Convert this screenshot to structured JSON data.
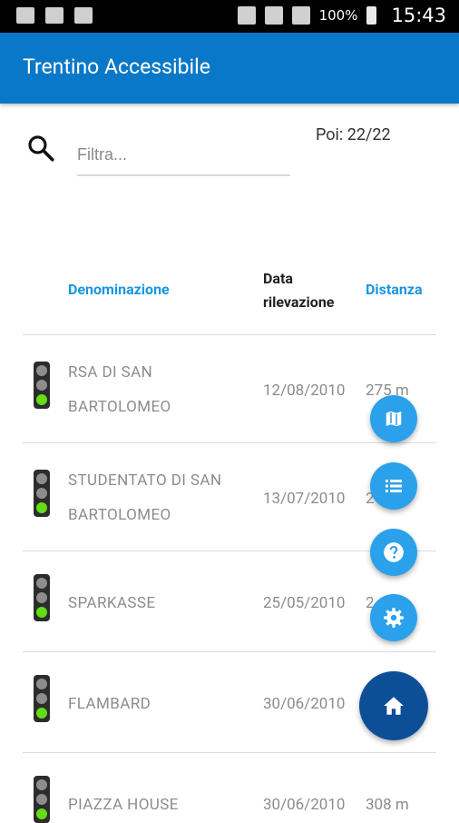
{
  "status_bar": {
    "battery": "100%",
    "time": "15:43"
  },
  "app_bar": {
    "title": "Trentino Accessibile"
  },
  "search": {
    "placeholder": "Filtra...",
    "value": ""
  },
  "poi_count": "Poi: 22/22",
  "columns": {
    "name": "Denominazione",
    "date": "Data rilevazione",
    "distance": "Distanza"
  },
  "rows": [
    {
      "name": "RSA DI SAN BARTOLOMEO",
      "date": "12/08/2010",
      "distance": "275 m",
      "status": "green"
    },
    {
      "name": "STUDENTATO DI SAN BARTOLOMEO",
      "date": "13/07/2010",
      "distance": "2",
      "status": "green"
    },
    {
      "name": "SPARKASSE",
      "date": "25/05/2010",
      "distance": "2",
      "status": "green"
    },
    {
      "name": "FLAMBARD",
      "date": "30/06/2010",
      "distance": "",
      "status": "green"
    },
    {
      "name": "PIAZZA HOUSE",
      "date": "30/06/2010",
      "distance": "308 m",
      "status": "green"
    }
  ],
  "fabs": [
    "map-icon",
    "list-icon",
    "help-icon",
    "settings-icon",
    "home-icon"
  ],
  "colors": {
    "primary": "#0a78c8",
    "accent": "#2aa1ea",
    "home_fab": "#0d4f97",
    "light_green": "#64dd17"
  }
}
